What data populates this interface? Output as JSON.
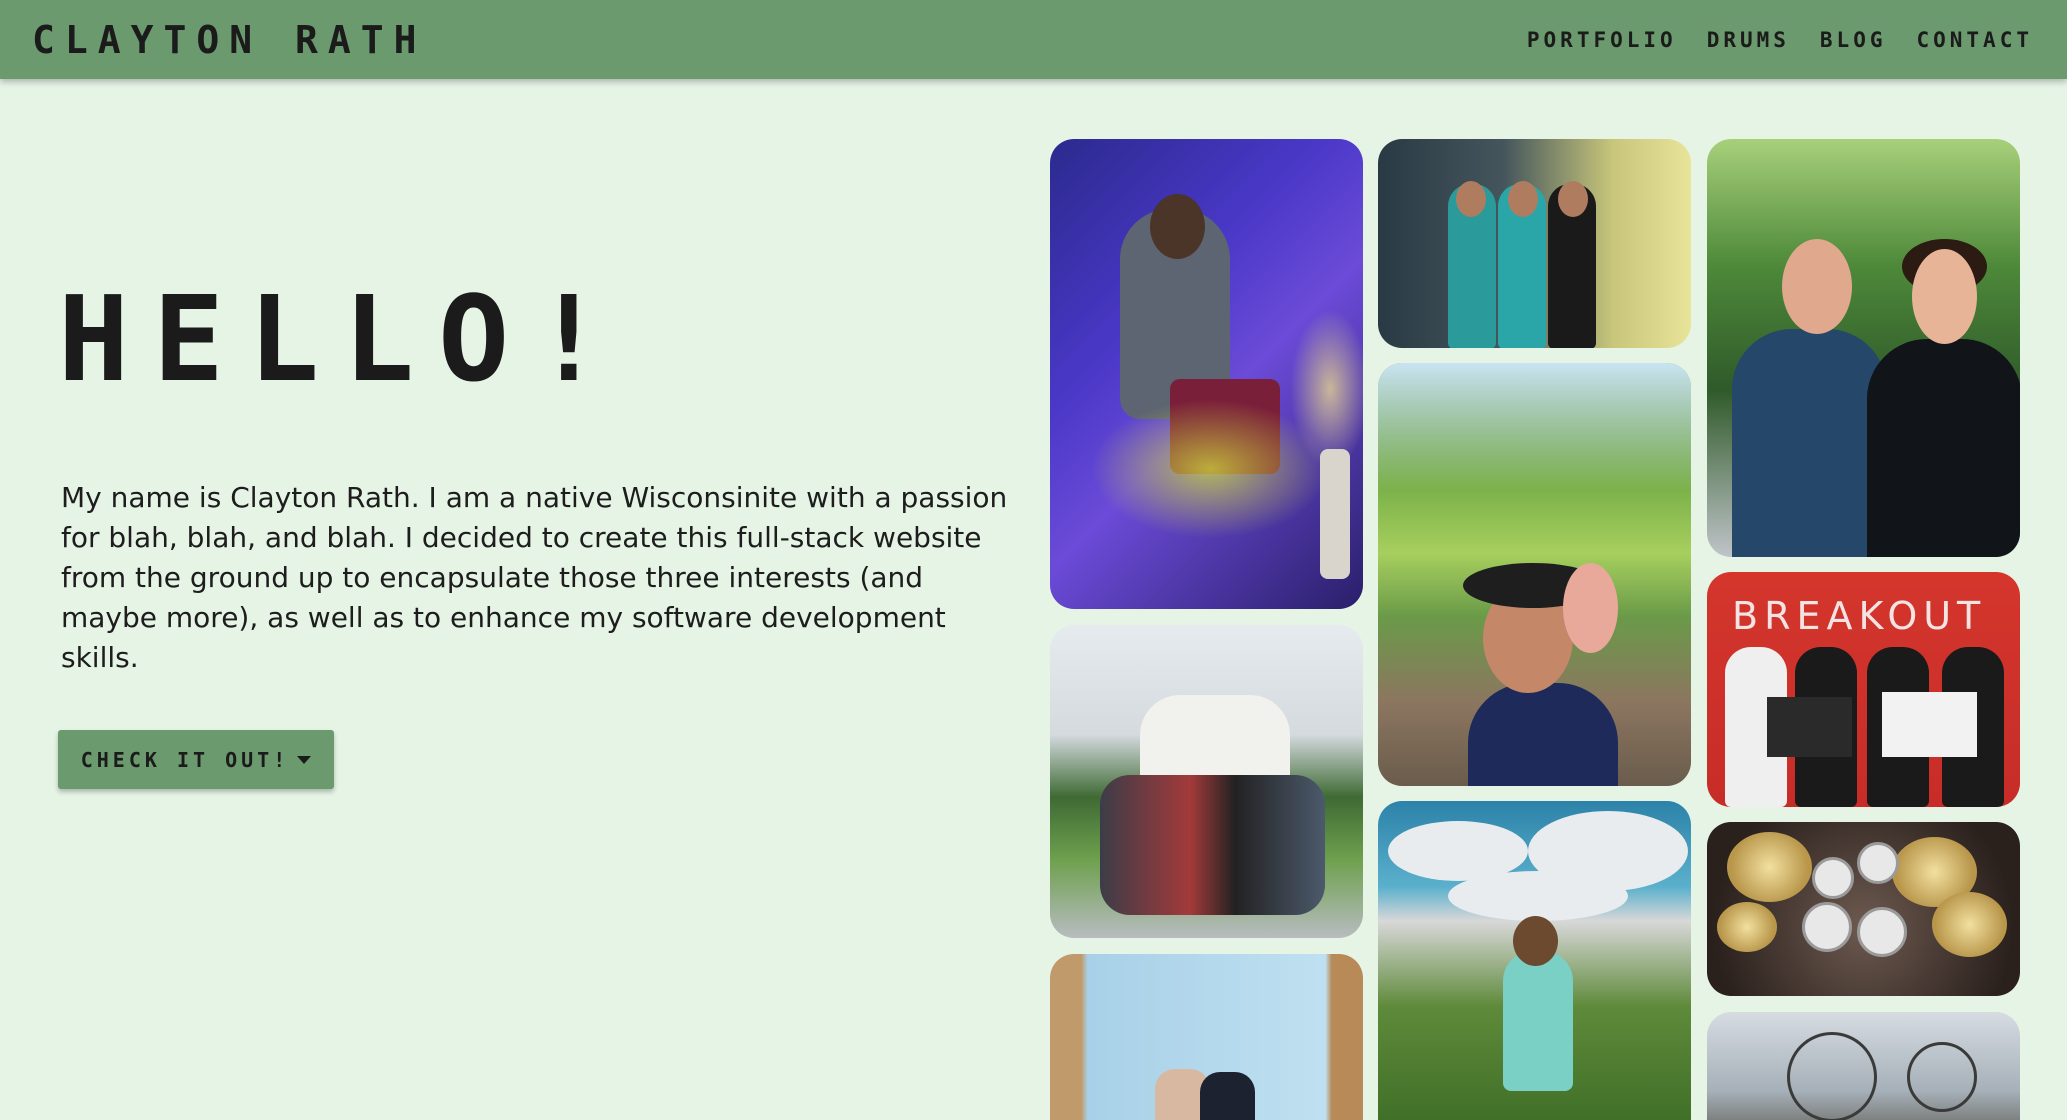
{
  "brand": "CLAYTON RATH",
  "nav": {
    "items": [
      {
        "label": "PORTFOLIO"
      },
      {
        "label": "DRUMS"
      },
      {
        "label": "BLOG"
      },
      {
        "label": "CONTACT"
      }
    ]
  },
  "hero": {
    "title": "HELLO!",
    "intro": "My name is Clayton Rath. I am a native Wisconsinite with a passion for blah, blah, and blah. I decided to create this full-stack website from the ground up to encapsulate those three interests (and maybe more), as well as to enhance my software development skills.",
    "cta_label": "CHECK IT OUT!"
  },
  "gallery": {
    "photos": [
      {
        "subject": "drummer-on-stage"
      },
      {
        "subject": "three-friends-arena"
      },
      {
        "subject": "graduation-with-father"
      },
      {
        "subject": "campus-group-photo"
      },
      {
        "subject": "selfie-in-forest"
      },
      {
        "subject": "breakout-escape-room"
      },
      {
        "subject": "drum-kit-overhead"
      },
      {
        "subject": "field-with-clouds"
      },
      {
        "subject": "two-friends-canyon"
      },
      {
        "subject": "mountain-hike"
      }
    ],
    "breakout_text": "BREAKOUT"
  },
  "colors": {
    "background": "#e6f4e6",
    "navbar": "#6a9a6d",
    "text": "#1b1b1b"
  }
}
